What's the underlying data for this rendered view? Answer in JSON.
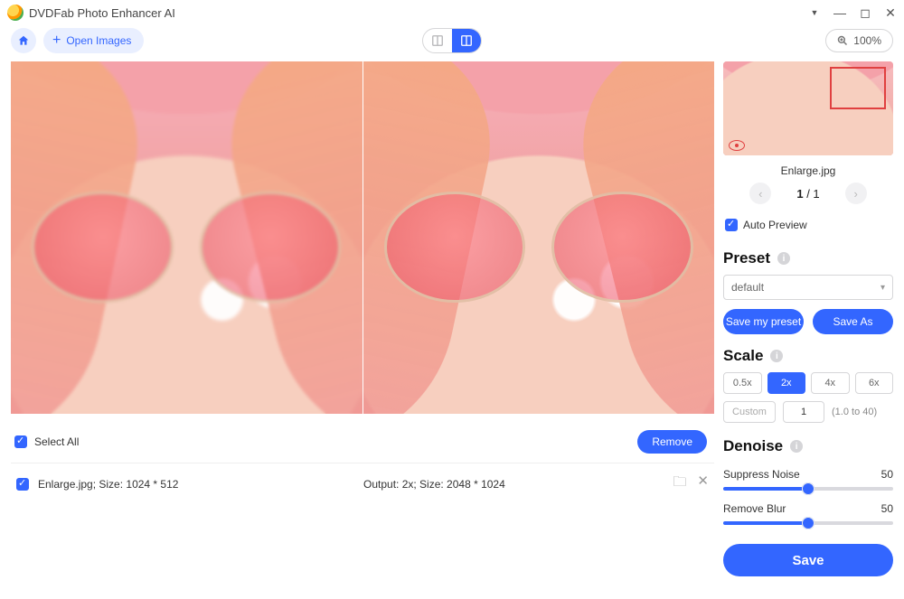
{
  "app": {
    "title": "DVDFab Photo Enhancer AI"
  },
  "toolbar": {
    "open_label": "Open Images",
    "zoom_label": "100%"
  },
  "list": {
    "select_all_label": "Select All",
    "remove_label": "Remove",
    "rows": [
      {
        "name": "Enlarge.jpg; Size: 1024 * 512",
        "output": "Output: 2x; Size: 2048 * 1024"
      }
    ]
  },
  "side": {
    "filename": "Enlarge.jpg",
    "pager_current": "1",
    "pager_sep": " / ",
    "pager_total": "1",
    "auto_preview_label": "Auto Preview",
    "preset": {
      "title": "Preset",
      "selected": "default",
      "save_my": "Save my preset",
      "save_as": "Save As"
    },
    "scale": {
      "title": "Scale",
      "options": [
        "0.5x",
        "2x",
        "4x",
        "6x"
      ],
      "active": "2x",
      "custom_label": "Custom",
      "custom_value": "1",
      "range_hint": "(1.0 to 40)"
    },
    "denoise": {
      "title": "Denoise",
      "suppress_label": "Suppress Noise",
      "suppress_value": "50",
      "blur_label": "Remove Blur",
      "blur_value": "50"
    },
    "save_label": "Save"
  }
}
